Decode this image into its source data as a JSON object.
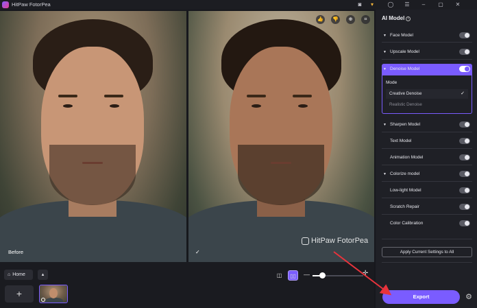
{
  "app": {
    "title": "HitPaw FotorPea"
  },
  "titlebar": {
    "icons": [
      "discord-icon",
      "cart-icon",
      "account-icon",
      "menu-icon",
      "minimize-icon",
      "maximize-icon",
      "close-icon"
    ]
  },
  "preview": {
    "before_label": "Before",
    "after_check": "✓",
    "watermark": "HitPaw FotorPea"
  },
  "bottom": {
    "home_label": "Home",
    "add_label": "+",
    "zoom_level": 0.2
  },
  "panel": {
    "title": "AI Model",
    "models": [
      {
        "label": "Face Model",
        "caret": true
      },
      {
        "label": "Upscale Model",
        "caret": true
      },
      {
        "label": "Denoise Model",
        "caret": true,
        "active": true
      },
      {
        "label": "Sharpen Model",
        "caret": true
      },
      {
        "label": "Text Model",
        "caret": false
      },
      {
        "label": "Animation Model",
        "caret": false
      },
      {
        "label": "Colorize model",
        "caret": true
      },
      {
        "label": "Low-light Model",
        "caret": false
      },
      {
        "label": "Scratch Repair",
        "caret": false
      },
      {
        "label": "Color Calibration",
        "caret": false
      }
    ],
    "mode": {
      "title": "Mode",
      "options": [
        "Creative Denoise",
        "Realistic Denoise"
      ],
      "selected": "Creative Denoise"
    },
    "apply_label": "Apply Current Settings to All",
    "export_label": "Export"
  },
  "colors": {
    "accent": "#7a5cff",
    "annotation": "#e8333c"
  }
}
